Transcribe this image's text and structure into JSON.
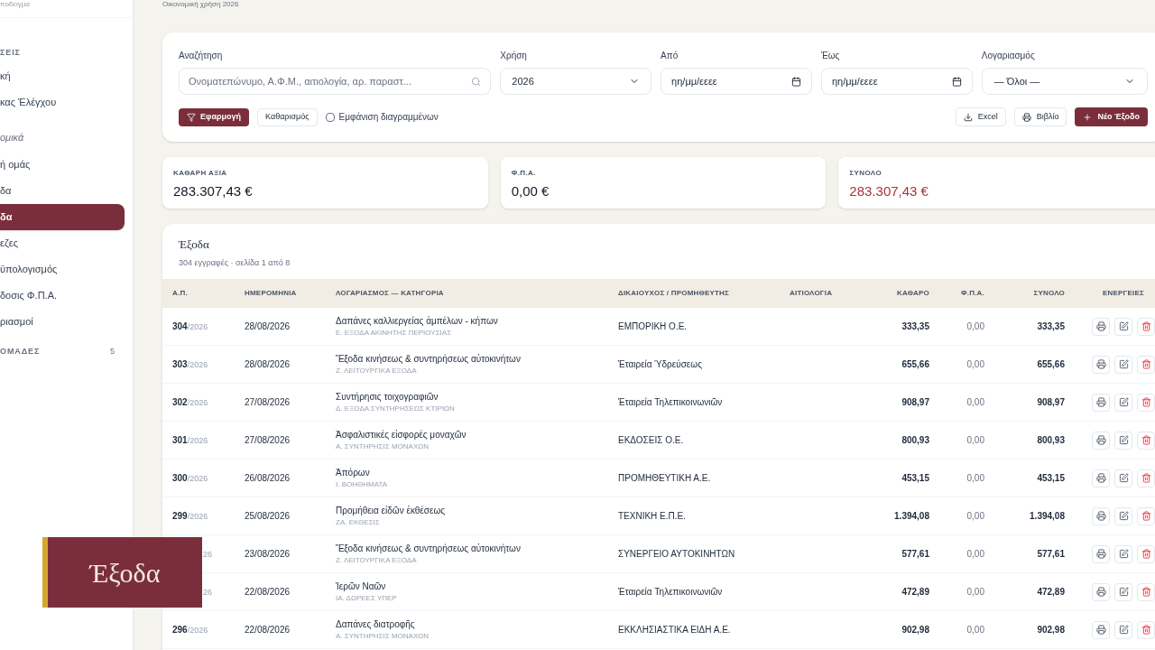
{
  "sidebar": {
    "subtitle": "ποδειγμα",
    "items": [
      {
        "kind": "header",
        "label": "ΣΕΙΣ",
        "selected": false
      },
      {
        "kind": "item",
        "label": "κή",
        "selected": false
      },
      {
        "kind": "item",
        "label": "κας Έλέγχου",
        "selected": false
      },
      {
        "kind": "group",
        "label": "ομικά",
        "selected": false
      },
      {
        "kind": "item",
        "label": "ή ομάς",
        "selected": false
      },
      {
        "kind": "item",
        "label": "δα",
        "selected": false
      },
      {
        "kind": "item",
        "label": "δα",
        "selected": true
      },
      {
        "kind": "item",
        "label": "εζες",
        "selected": false
      },
      {
        "kind": "item",
        "label": "ϋπολογισμός",
        "selected": false
      },
      {
        "kind": "item",
        "label": "δοσις Φ.Π.Α.",
        "selected": false
      },
      {
        "kind": "item",
        "label": "ριασμοί",
        "selected": false
      },
      {
        "kind": "header",
        "label": "ΟΜΑΔΕΣ",
        "count": "5",
        "selected": false
      }
    ]
  },
  "header": {
    "subtitle": "Οικονομική χρήση 2026"
  },
  "filters": {
    "search": {
      "label": "Αναζήτηση",
      "placeholder": "Ονοματεπώνυμο, Α.Φ.Μ., αιτιολογία, αρ. παραστ..."
    },
    "year": {
      "label": "Χρήση",
      "value": "2026"
    },
    "from": {
      "label": "Από",
      "placeholder": "ηη/μμ/εεεε"
    },
    "to": {
      "label": "Έως",
      "placeholder": "ηη/μμ/εεεε"
    },
    "account": {
      "label": "Λογαριασμός",
      "value": "— Όλοι —"
    },
    "apply": "Εφαρμογή",
    "clear": "Καθαρισμός",
    "show_deleted": {
      "label": "Εμφάνιση διαγραμμένων",
      "checked": false
    },
    "excel": "Excel",
    "book": "Βιβλίο",
    "new": "Νέο Έξοδο"
  },
  "stats": [
    {
      "kind": "normal",
      "label": "ΚΑΘΑΡΗ ΑΞΙΑ",
      "value": "283.307,43 €"
    },
    {
      "kind": "normal",
      "label": "Φ.Π.Α.",
      "value": "0,00 €"
    },
    {
      "kind": "total",
      "label": "ΣΥΝΟΛΟ",
      "value": "283.307,43 €"
    }
  ],
  "table": {
    "title": "Έξοδα",
    "subtitle": "304 εγγραφές · σελίδα 1 από 8",
    "columns": [
      "Α.Π.",
      "ΗΜΕΡΟΜΗΝΙΑ",
      "ΛΟΓΑΡΙΑΣΜΟΣ — ΚΑΤΗΓΟΡΙΑ",
      "ΔΙΚΑΙΟΥΧΟΣ / ΠΡΟΜΗΘΕΥΤΗΣ",
      "ΑΙΤΙΟΛΟΓΙΑ",
      "ΚΑΘΑΡΟ",
      "Φ.Π.Α.",
      "ΣΥΝΟΛΟ",
      "ΕΝΕΡΓΕΙΕΣ"
    ],
    "rows": [
      {
        "number": "304",
        "year": "/2026",
        "date": "28/08/2026",
        "account": "Δαπάνες καλλιεργείας ἀμπέλων - κήπων",
        "category": "Ε. ΕΞΟΔΑ ΑΚΙΝΗΤΗΣ ΠΕΡΙΟΥΣΙΑΣ",
        "payee": "ΕΜΠΟΡΙΚΗ Ο.Ε.",
        "net": "333,35",
        "vat": "0,00",
        "total": "333,35"
      },
      {
        "number": "303",
        "year": "/2026",
        "date": "28/08/2026",
        "account": "Ἔξοδα κινήσεως & συντηρήσεως αὐτοκινήτων",
        "category": "Ζ. ΛΕΙΤΟΥΡΓΙΚΑ ΕΞΟΔΑ",
        "payee": "Ἑταιρεία Ὑδρεύσεως",
        "net": "655,66",
        "vat": "0,00",
        "total": "655,66"
      },
      {
        "number": "302",
        "year": "/2026",
        "date": "27/08/2026",
        "account": "Συντήρησις τοιχογραφιῶν",
        "category": "Δ. ΕΞΟΔΑ ΣΥΝΤΗΡΗΣΕΩΣ ΚΤΙΡΙΩΝ",
        "payee": "Ἑταιρεία Τηλεπικοινωνιῶν",
        "net": "908,97",
        "vat": "0,00",
        "total": "908,97"
      },
      {
        "number": "301",
        "year": "/2026",
        "date": "27/08/2026",
        "account": "Ἀσφαλιστικές εἰσφορές μοναχῶν",
        "category": "Α. ΣΥΝΤΗΡΗΣΙΣ ΜΟΝΑΧΩΝ",
        "payee": "ΕΚΔΟΣΕΙΣ Ο.Ε.",
        "net": "800,93",
        "vat": "0,00",
        "total": "800,93"
      },
      {
        "number": "300",
        "year": "/2026",
        "date": "26/08/2026",
        "account": "Ἀπόρων",
        "category": "Ι. ΒΟΗΘΗΜΑΤΑ",
        "payee": "ΠΡΟΜΗΘΕΥΤΙΚΗ Α.Ε.",
        "net": "453,15",
        "vat": "0,00",
        "total": "453,15"
      },
      {
        "number": "299",
        "year": "/2026",
        "date": "25/08/2026",
        "account": "Προμήθεια εἰδῶν ἐκθέσεως",
        "category": "ΖΑ. ΕΚΘΕΣΙΣ",
        "payee": "ΤΕΧΝΙΚΗ Ε.Π.Ε.",
        "net": "1.394,08",
        "vat": "0,00",
        "total": "1.394,08"
      },
      {
        "year": "26",
        "date": "23/08/2026",
        "account": "Ἔξοδα κινήσεως & συντηρήσεως αὐτοκινήτων",
        "category": "Ζ. ΛΕΙΤΟΥΡΓΙΚΑ ΕΞΟΔΑ",
        "payee": "ΣΥΝΕΡΓΕΙΟ ΑΥΤΟΚΙΝΗΤΩΝ",
        "net": "577,61",
        "vat": "0,00",
        "total": "577,61"
      },
      {
        "year": "26",
        "date": "22/08/2026",
        "account": "Ἱερῶν Ναῶν",
        "category": "ΙΑ. ΔΩΡΕΕΣ ΥΠΕΡ",
        "payee": "Ἑταιρεία Τηλεπικοινωνιῶν",
        "net": "472,89",
        "vat": "0,00",
        "total": "472,89"
      },
      {
        "number": "296",
        "year": "/2026",
        "date": "22/08/2026",
        "account": "Δαπάνες διατροφῆς",
        "category": "Α. ΣΥΝΤΗΡΗΣΙΣ ΜΟΝΑΧΩΝ",
        "payee": "ΕΚΚΛΗΣΙΑΣΤΙΚΑ ΕΙΔΗ Α.Ε.",
        "net": "902,98",
        "vat": "0,00",
        "total": "902,98"
      }
    ]
  },
  "overlay": {
    "title": "Έξοδα"
  }
}
